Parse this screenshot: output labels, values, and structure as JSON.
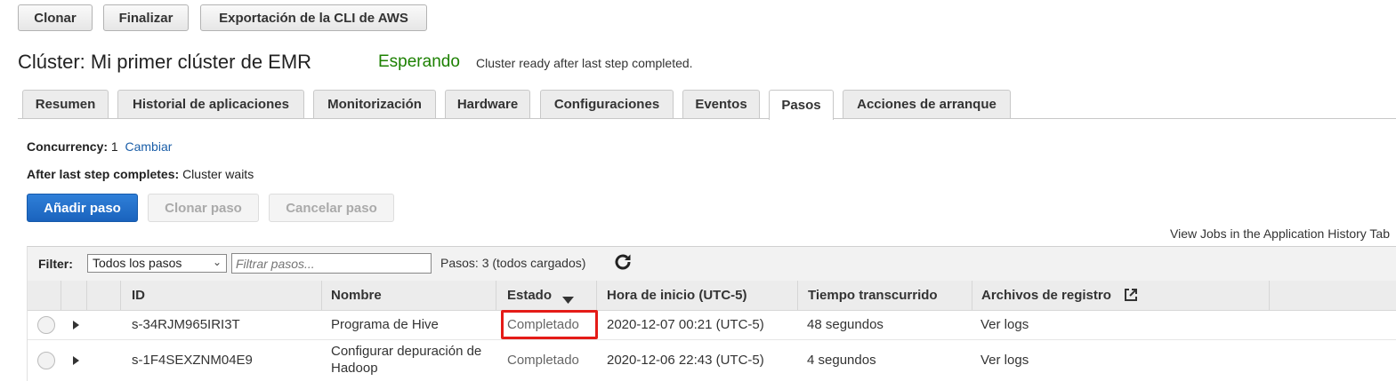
{
  "toolbar": {
    "clone": "Clonar",
    "terminate": "Finalizar",
    "cli_export": "Exportación de la CLI de AWS"
  },
  "cluster": {
    "title": "Clúster: Mi primer clúster de EMR",
    "status": "Esperando",
    "status_detail": "Cluster ready after last step completed.",
    "status_color": "#1d8102"
  },
  "tabs": [
    {
      "label": "Resumen"
    },
    {
      "label": "Historial de aplicaciones"
    },
    {
      "label": "Monitorización"
    },
    {
      "label": "Hardware"
    },
    {
      "label": "Configuraciones"
    },
    {
      "label": "Eventos"
    },
    {
      "label": "Pasos",
      "active": true
    },
    {
      "label": "Acciones de arranque"
    }
  ],
  "steps_panel": {
    "concurrency_label": "Concurrency:",
    "concurrency_value": "1",
    "change_link": "Cambiar",
    "after_label": "After last step completes:",
    "after_value": "Cluster waits",
    "add_step": "Añadir paso",
    "clone_step": "Clonar paso",
    "cancel_step": "Cancelar paso",
    "history_link": "View Jobs in the Application History Tab"
  },
  "filter": {
    "label": "Filter:",
    "selected": "Todos los pasos",
    "placeholder": "Filtrar pasos...",
    "count_text": "Pasos: 3 (todos cargados)"
  },
  "table": {
    "columns": [
      "ID",
      "Nombre",
      "Estado",
      "Hora de inicio (UTC-5)",
      "Tiempo transcurrido",
      "Archivos de registro"
    ],
    "rows": [
      {
        "id": "s-34RJM965IRI3T",
        "name": "Programa de Hive",
        "status": "Completado",
        "start": "2020-12-07 00:21 (UTC-5)",
        "elapsed": "48 segundos",
        "logs": "Ver logs"
      },
      {
        "id": "s-1F4SEXZNM04E9",
        "name": "Configurar depuración de Hadoop",
        "status": "Completado",
        "start": "2020-12-06 22:43 (UTC-5)",
        "elapsed": "4 segundos",
        "logs": "Ver logs"
      }
    ]
  },
  "colors": {
    "primary_button": "#1a63bd",
    "link": "#1a5ea8",
    "highlight_box": "#e41b17"
  }
}
